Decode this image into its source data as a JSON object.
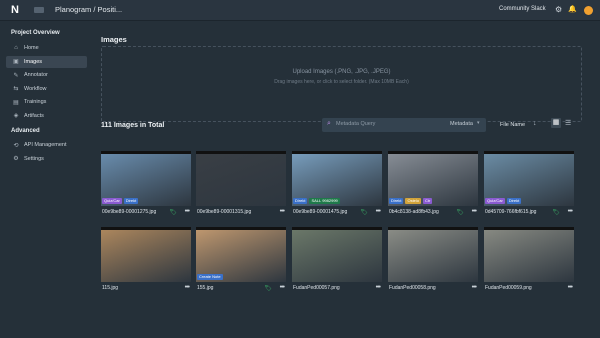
{
  "header": {
    "logo": "N",
    "breadcrumb": "Planogram / Positi...",
    "community": "Community Slack",
    "icons": [
      "gear-icon",
      "bell-icon",
      "avatar"
    ]
  },
  "sidebar": {
    "section_project": "Project Overview",
    "items": [
      {
        "label": "Home",
        "icon": "home-icon",
        "glyph": "⌂"
      },
      {
        "label": "Images",
        "icon": "image-icon",
        "glyph": "▣",
        "active": true
      },
      {
        "label": "Annotator",
        "icon": "annotator-icon",
        "glyph": "✎"
      },
      {
        "label": "Workflow",
        "icon": "workflow-icon",
        "glyph": "⇆"
      },
      {
        "label": "Trainings",
        "icon": "trainings-icon",
        "glyph": "▤"
      },
      {
        "label": "Artifacts",
        "icon": "artifacts-icon",
        "glyph": "◈"
      }
    ],
    "section_advanced": "Advanced",
    "adv_items": [
      {
        "label": "API Management",
        "icon": "api-icon",
        "glyph": "⟲"
      },
      {
        "label": "Settings",
        "icon": "settings-icon",
        "glyph": "⚙"
      }
    ]
  },
  "main": {
    "title": "Images",
    "upload_title": "Upload Images (.PNG, .JPG, .JPEG)",
    "upload_hint": "Drag images here, or click to select folder. (Max 10MB Each)",
    "count": "111 Images in Total",
    "search_placeholder": "Metadata Query",
    "search_mode": "Metadata",
    "sort_label": "File Name"
  },
  "colors": {
    "accent": "#b98be0",
    "tag_green": "#3ec86f",
    "tag_blue": "#3a70c8",
    "tag_purple": "#8a5bd1",
    "tag_gold": "#d1a33a"
  },
  "cards": [
    {
      "name": "00e9be89-00001275.jpg",
      "tags": [
        {
          "t": "Quiz/Car",
          "c": "#8a5bd1"
        },
        {
          "t": "Direkt",
          "c": "#3a70c8"
        }
      ],
      "tag": true
    },
    {
      "name": "00e9be89-00001315.jpg",
      "tags": [],
      "tag": false
    },
    {
      "name": "00e9be89-00001475.jpg",
      "tags": [
        {
          "t": "Direkt",
          "c": "#3a70c8"
        },
        {
          "t": "SALL 9982999",
          "c": "#1f7a4a"
        }
      ],
      "tag": true
    },
    {
      "name": "0b4c8138-ad8fb43.jpg",
      "tags": [
        {
          "t": "Direkt",
          "c": "#3a70c8"
        },
        {
          "t": "Ostelo",
          "c": "#d1a33a"
        },
        {
          "t": "Ctr",
          "c": "#8a5bd1"
        }
      ],
      "tag": true
    },
    {
      "name": "0d45709-766fbf615.jpg",
      "tags": [
        {
          "t": "Quiz/Car",
          "c": "#8a5bd1"
        },
        {
          "t": "Direkt",
          "c": "#3a70c8"
        }
      ],
      "tag": true
    },
    {
      "name": "115.jpg",
      "tags": [],
      "tag": false
    },
    {
      "name": "155.jpg",
      "tags": [
        {
          "t": "Create Note",
          "c": "#3a70c8"
        }
      ],
      "tag": true
    },
    {
      "name": "FudanPed00057.png",
      "tags": [],
      "tag": false
    },
    {
      "name": "FudanPed00058.png",
      "tags": [],
      "tag": false
    },
    {
      "name": "FudanPed00059.png",
      "tags": [],
      "tag": false
    }
  ]
}
